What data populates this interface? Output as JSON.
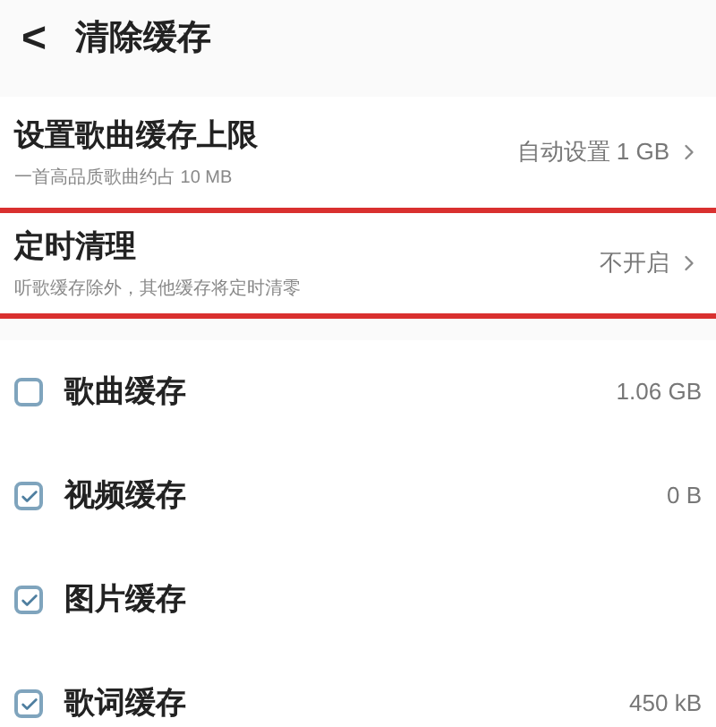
{
  "header": {
    "back": "<",
    "title": "清除缓存"
  },
  "settings": [
    {
      "title": "设置歌曲缓存上限",
      "subtitle": "一首高品质歌曲约占 10 MB",
      "value": "自动设置 1 GB",
      "highlighted": false
    },
    {
      "title": "定时清理",
      "subtitle": "听歌缓存除外，其他缓存将定时清零",
      "value": "不开启",
      "highlighted": true
    }
  ],
  "caches": [
    {
      "label": "歌曲缓存",
      "size": "1.06 GB",
      "checked": false
    },
    {
      "label": "视频缓存",
      "size": "0 B",
      "checked": true
    },
    {
      "label": "图片缓存",
      "checked": true
    },
    {
      "label": "歌词缓存",
      "size": "450 kB",
      "checked": true
    }
  ]
}
